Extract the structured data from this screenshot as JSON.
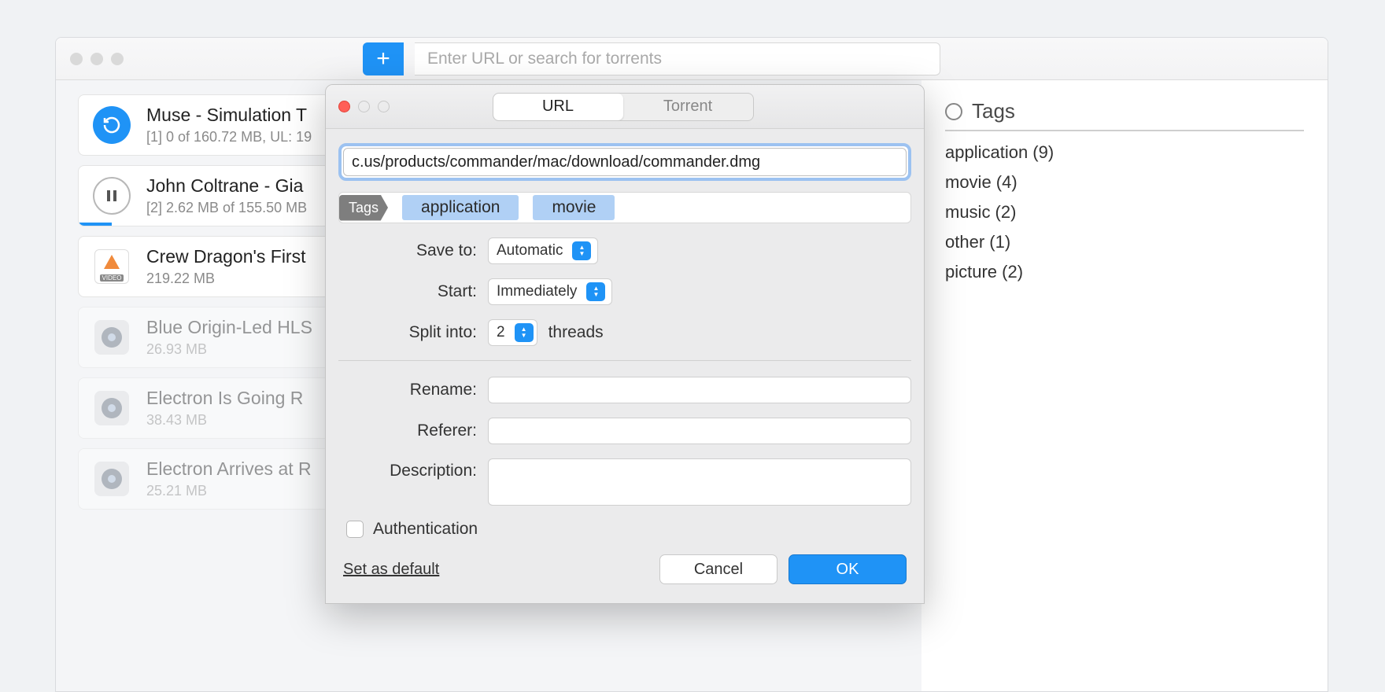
{
  "titlebar": {
    "search_placeholder": "Enter URL or search for torrents"
  },
  "downloads": [
    {
      "icon": "refresh",
      "title": "Muse - Simulation T",
      "sub": "[1] 0 of 160.72 MB, UL: 19"
    },
    {
      "icon": "pause",
      "title": "John Coltrane - Gia",
      "sub": "[2] 2.62 MB of 155.50 MB",
      "progress": 4
    },
    {
      "icon": "video",
      "title": "Crew Dragon's First",
      "sub": "219.22 MB"
    },
    {
      "icon": "mp4",
      "title": "Blue Origin-Led HLS",
      "sub": "26.93 MB",
      "faded": true
    },
    {
      "icon": "mp4",
      "title": "Electron Is Going R",
      "sub": "38.43 MB",
      "faded": true
    },
    {
      "icon": "mp4",
      "title": "Electron Arrives at R",
      "sub": "25.21 MB",
      "faded": true
    }
  ],
  "sidebar": {
    "title": "Tags",
    "items": [
      "application (9)",
      "movie (4)",
      "music (2)",
      "other (1)",
      "picture (2)"
    ]
  },
  "modal": {
    "tabs": {
      "url": "URL",
      "torrent": "Torrent"
    },
    "url_value": "c.us/products/commander/mac/download/commander.dmg",
    "tags_label": "Tags",
    "tag_chips": [
      "application",
      "movie"
    ],
    "save_to_label": "Save to:",
    "save_to_value": "Automatic",
    "start_label": "Start:",
    "start_value": "Immediately",
    "split_label": "Split into:",
    "split_value": "2",
    "split_suffix": "threads",
    "rename_label": "Rename:",
    "referer_label": "Referer:",
    "description_label": "Description:",
    "auth_label": "Authentication",
    "set_default": "Set as default",
    "cancel": "Cancel",
    "ok": "OK"
  }
}
